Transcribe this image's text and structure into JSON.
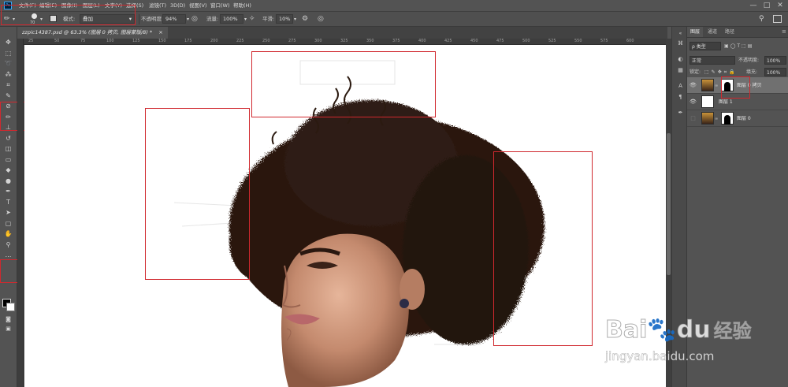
{
  "app": {
    "logo": "Ps"
  },
  "menu": [
    "文件(F)",
    "编辑(E)",
    "图像(I)",
    "图层(L)",
    "文字(Y)",
    "选择(S)",
    "滤镜(T)",
    "3D(D)",
    "视图(V)",
    "窗口(W)",
    "帮助(H)"
  ],
  "window_controls": {
    "minimize": "—",
    "maximize": "□",
    "close": "✕"
  },
  "options": {
    "brush_size": "70",
    "mode_label": "模式:",
    "mode_value": "叠加",
    "opacity_label": "不透明度:",
    "opacity_value": "94%",
    "flow_label": "流量:",
    "flow_value": "100%",
    "smooth_label": "平滑:",
    "smooth_value": "10%"
  },
  "document_tab": {
    "title": "zzpic14387.psd @ 63.3% (图层 0 拷贝, 图层蒙版/8) *",
    "close": "×"
  },
  "ruler_ticks": [
    "25",
    "50",
    "75",
    "100",
    "125",
    "150",
    "175",
    "200",
    "225",
    "250",
    "275",
    "300",
    "325",
    "350",
    "375",
    "400",
    "425",
    "450",
    "475",
    "500",
    "525",
    "550",
    "575",
    "600"
  ],
  "tools": [
    {
      "name": "move-tool-icon",
      "glyph": "✥"
    },
    {
      "name": "marquee-tool-icon",
      "glyph": "⬚"
    },
    {
      "name": "lasso-tool-icon",
      "glyph": "➰"
    },
    {
      "name": "quick-select-tool-icon",
      "glyph": "⁂"
    },
    {
      "name": "crop-tool-icon",
      "glyph": "⌗"
    },
    {
      "name": "eyedropper-tool-icon",
      "glyph": "✎"
    },
    {
      "name": "spot-heal-tool-icon",
      "glyph": "⊘"
    },
    {
      "name": "brush-tool-icon",
      "glyph": "✏"
    },
    {
      "name": "stamp-tool-icon",
      "glyph": "⊥"
    },
    {
      "name": "history-brush-tool-icon",
      "glyph": "↺"
    },
    {
      "name": "eraser-tool-icon",
      "glyph": "◫"
    },
    {
      "name": "gradient-tool-icon",
      "glyph": "▭"
    },
    {
      "name": "blur-tool-icon",
      "glyph": "◆"
    },
    {
      "name": "dodge-tool-icon",
      "glyph": "●"
    },
    {
      "name": "pen-tool-icon",
      "glyph": "✒"
    },
    {
      "name": "type-tool-icon",
      "glyph": "T"
    },
    {
      "name": "path-select-tool-icon",
      "glyph": "➤"
    },
    {
      "name": "shape-tool-icon",
      "glyph": "▢"
    },
    {
      "name": "hand-tool-icon",
      "glyph": "✋"
    },
    {
      "name": "zoom-tool-icon",
      "glyph": "⚲"
    },
    {
      "name": "more-tools-icon",
      "glyph": "…"
    }
  ],
  "layers_panel": {
    "tabs": [
      "图层",
      "通道",
      "路径"
    ],
    "filter_label": "ρ 类型",
    "blend_mode": "正常",
    "opacity_label": "不透明度:",
    "opacity_value": "100%",
    "lock_label": "锁定:",
    "fill_label": "填充:",
    "fill_value": "100%",
    "layers": [
      {
        "name": "图层 0 拷贝",
        "visible": true,
        "selected": true
      },
      {
        "name": "图层 1",
        "visible": true,
        "selected": false
      },
      {
        "name": "图层 0",
        "visible": false,
        "selected": false
      }
    ]
  },
  "watermark": {
    "brand": "Bai",
    "brand2": "du",
    "cn": "经验",
    "url": "jingyan.baidu.com"
  },
  "colors": {
    "annotation_red": "#d0282e",
    "ui_dark": "#535353",
    "ps_blue": "#31a8ff"
  }
}
